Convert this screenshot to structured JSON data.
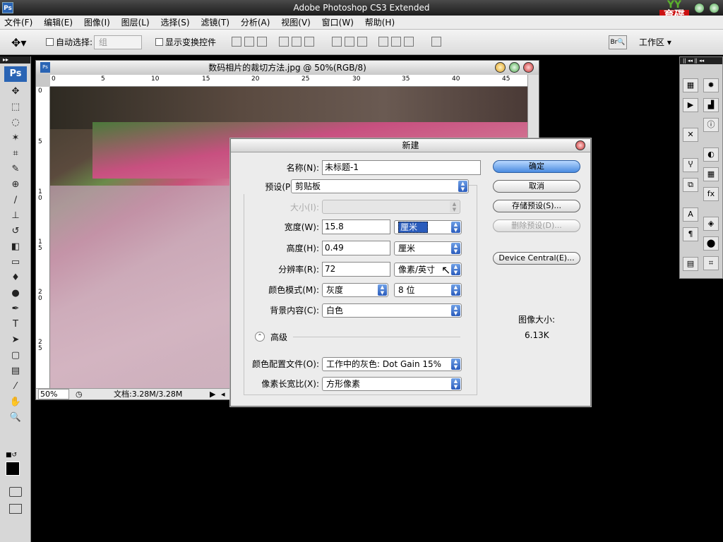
{
  "app": {
    "title": "Adobe Photoshop CS3 Extended",
    "logo": "Ps",
    "watermark": "育碟软件"
  },
  "menu": [
    "文件(F)",
    "编辑(E)",
    "图像(I)",
    "图层(L)",
    "选择(S)",
    "滤镜(T)",
    "分析(A)",
    "视图(V)",
    "窗口(W)",
    "帮助(H)"
  ],
  "options": {
    "auto_select_label": "自动选择:",
    "auto_select_value": "组",
    "show_transform_label": "显示变换控件",
    "workspace_label": "工作区 ▾"
  },
  "document": {
    "title": "数码相片的裁切方法.jpg @ 50%(RGB/8)",
    "ruler_h": [
      "0",
      "5",
      "10",
      "15",
      "20",
      "25",
      "30",
      "35",
      "40",
      "45"
    ],
    "ruler_v": [
      "0",
      "5",
      "1\n0",
      "1\n5",
      "2\n0",
      "2\n5"
    ],
    "zoom": "50%",
    "doc_info": "文档:3.28M/3.28M"
  },
  "dialog": {
    "title": "新建",
    "name_label": "名称(N):",
    "name_value": "未标题-1",
    "preset_label": "预设(P):",
    "preset_value": "剪贴板",
    "size_label": "大小(I):",
    "width_label": "宽度(W):",
    "width_value": "15.8",
    "width_unit": "厘米",
    "height_label": "高度(H):",
    "height_value": "0.49",
    "height_unit": "厘米",
    "resolution_label": "分辨率(R):",
    "resolution_value": "72",
    "resolution_unit": "像素/英寸",
    "color_mode_label": "颜色模式(M):",
    "color_mode_value": "灰度",
    "bit_depth": "8 位",
    "background_label": "背景内容(C):",
    "background_value": "白色",
    "advanced_label": "高级",
    "profile_label": "颜色配置文件(O):",
    "profile_value": "工作中的灰色: Dot Gain 15%",
    "aspect_label": "像素长宽比(X):",
    "aspect_value": "方形像素",
    "ok_label": "确定",
    "cancel_label": "取消",
    "save_preset_label": "存储预设(S)...",
    "delete_preset_label": "删除预设(D)...",
    "device_central_label": "Device Central(E)...",
    "image_size_label": "图像大小:",
    "image_size_value": "6.13K"
  },
  "colors": {
    "accent": "#2a5cbc",
    "titlebar": "#1c1c1c",
    "watermark": "#cc1111"
  }
}
